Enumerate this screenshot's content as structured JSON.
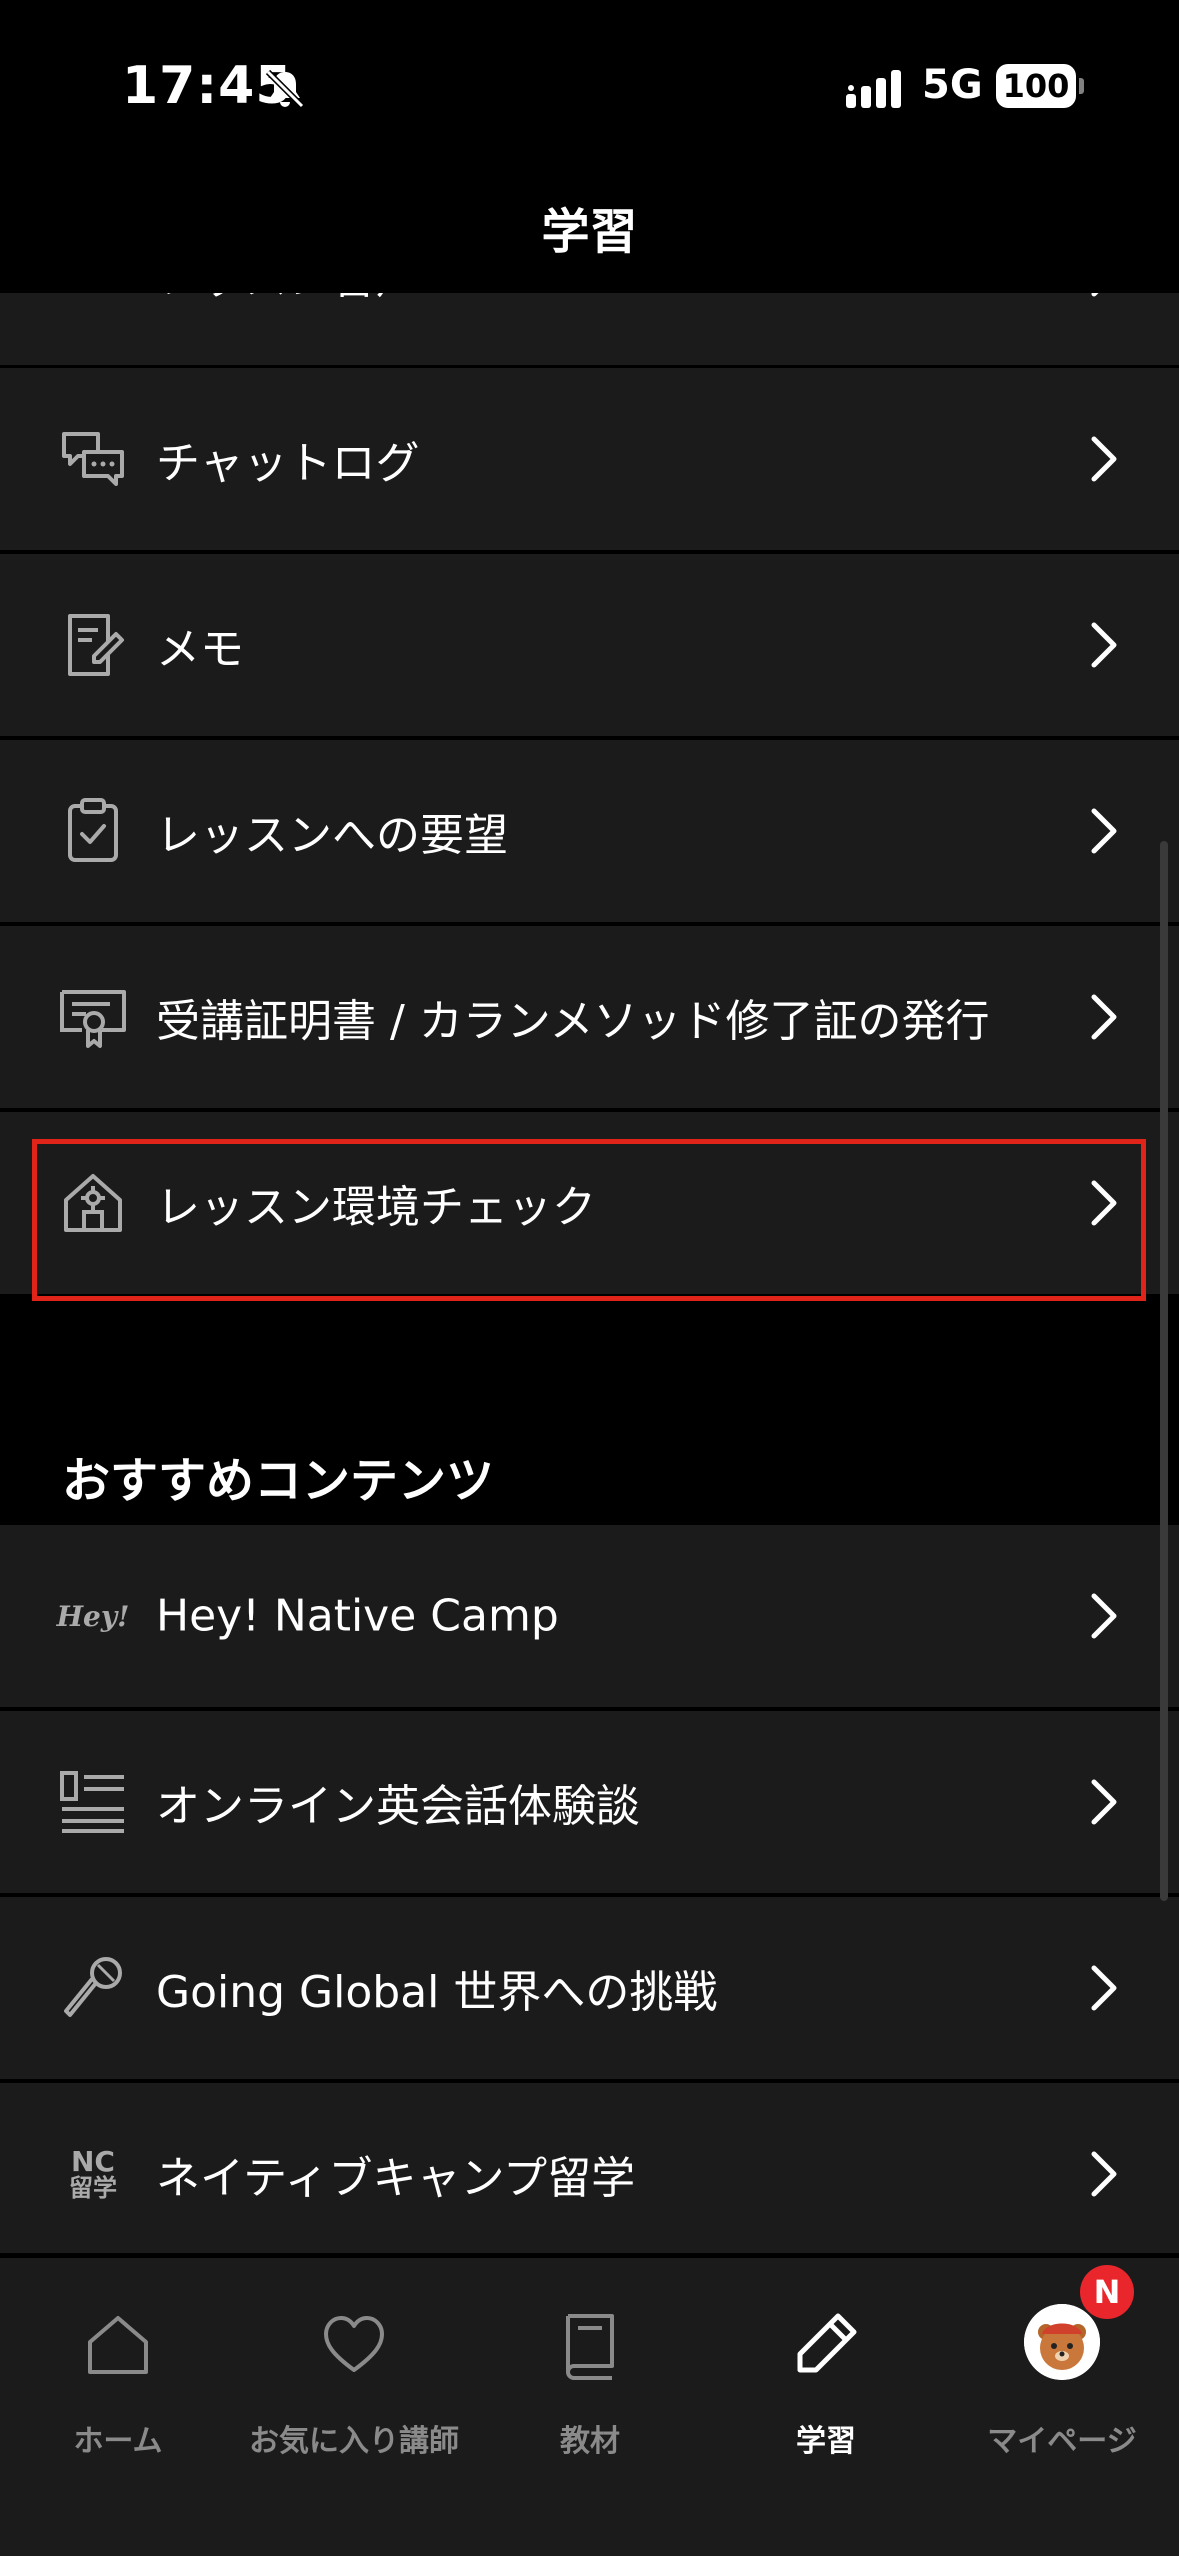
{
  "status_bar": {
    "time": "17:45",
    "network": "5G",
    "battery": "100"
  },
  "header": {
    "title": "学習"
  },
  "rows": [
    {
      "label": "レッスン音声",
      "icon": "microphone-icon"
    },
    {
      "label": "チャットログ",
      "icon": "chat-bubbles-icon"
    },
    {
      "label": "メモ",
      "icon": "memo-icon"
    },
    {
      "label": "レッスンへの要望",
      "icon": "clipboard-check-icon"
    },
    {
      "label": "受講証明書 / カランメソッド修了証の発行",
      "icon": "certificate-icon"
    },
    {
      "label": "レッスン環境チェック",
      "icon": "house-gear-icon"
    }
  ],
  "recommended": {
    "title": "おすすめコンテンツ",
    "items": [
      {
        "label": "Hey! Native Camp",
        "icon": "hey-logo-icon",
        "icon_text": "Hey!"
      },
      {
        "label": "オンライン英会話体験談",
        "icon": "article-list-icon"
      },
      {
        "label": "Going Global 世界への挑戦",
        "icon": "mic-stand-icon"
      },
      {
        "label": "ネイティブキャンプ留学",
        "icon": "nc-study-abroad-icon",
        "icon_text_top": "NC",
        "icon_text_bottom": "留学"
      }
    ]
  },
  "tabbar": {
    "tabs": [
      {
        "label": "ホーム",
        "icon": "home-icon"
      },
      {
        "label": "お気に入り講師",
        "icon": "heart-icon"
      },
      {
        "label": "教材",
        "icon": "book-icon"
      },
      {
        "label": "学習",
        "icon": "pencil-icon",
        "active": true
      },
      {
        "label": "マイページ",
        "icon": "avatar"
      }
    ],
    "badge": "N"
  },
  "colors": {
    "background": "#000000",
    "row": "#1b1b1b",
    "highlight": "#e0241a",
    "badge": "#e8262c",
    "inactive": "#8a8a8a"
  }
}
